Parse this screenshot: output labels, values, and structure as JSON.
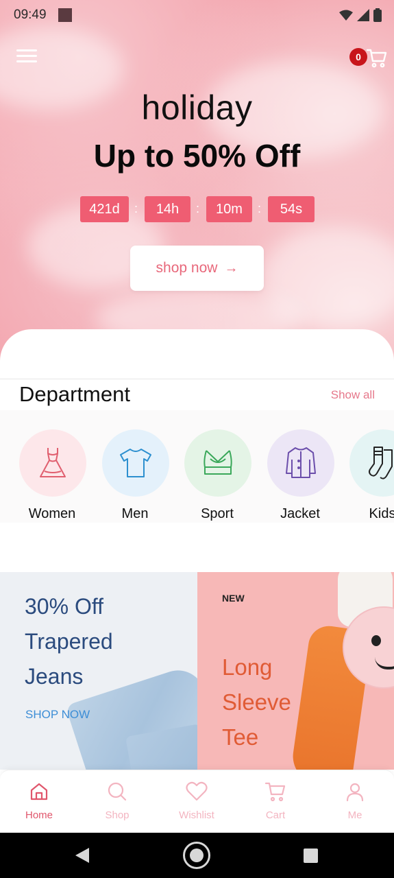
{
  "status_bar": {
    "time": "09:49"
  },
  "header": {
    "cart_count": "0"
  },
  "hero": {
    "kicker": "holiday",
    "title": "Up to 50% Off",
    "countdown": {
      "days": "421d",
      "hours": "14h",
      "minutes": "10m",
      "seconds": "54s",
      "separator": ":"
    },
    "cta_label": "shop now",
    "cta_arrow": "→"
  },
  "department": {
    "title": "Department",
    "show_all": "Show all",
    "items": [
      {
        "label": "Women",
        "icon": "dress-icon",
        "bg": "#fde7ea",
        "stroke": "#e05f6f"
      },
      {
        "label": "Men",
        "icon": "tshirt-icon",
        "bg": "#e4f1fb",
        "stroke": "#2c8fcf"
      },
      {
        "label": "Sport",
        "icon": "sports-bra-icon",
        "bg": "#e4f4e6",
        "stroke": "#3aa85a"
      },
      {
        "label": "Jacket",
        "icon": "jacket-icon",
        "bg": "#ece6f6",
        "stroke": "#6b4eab"
      },
      {
        "label": "Kids",
        "icon": "socks-icon",
        "bg": "#e4f4f4",
        "stroke": "#222222"
      }
    ]
  },
  "promos": {
    "left": {
      "lines": [
        "30% Off",
        "Trapered",
        "Jeans"
      ],
      "cta": "SHOP NOW"
    },
    "right": {
      "badge": "NEW",
      "lines": [
        "Long",
        "Sleeve",
        "Tee"
      ]
    }
  },
  "bottom_nav": {
    "items": [
      {
        "label": "Home",
        "icon": "home-icon",
        "active": true
      },
      {
        "label": "Shop",
        "icon": "search-icon",
        "active": false
      },
      {
        "label": "Wishlist",
        "icon": "heart-icon",
        "active": false
      },
      {
        "label": "Cart",
        "icon": "cart-icon",
        "active": false
      },
      {
        "label": "Me",
        "icon": "user-icon",
        "active": false
      }
    ]
  },
  "colors": {
    "accent": "#e0566c",
    "countdown_bg": "#ef5d72",
    "show_all": "#e6788b",
    "badge": "#c8151b"
  }
}
